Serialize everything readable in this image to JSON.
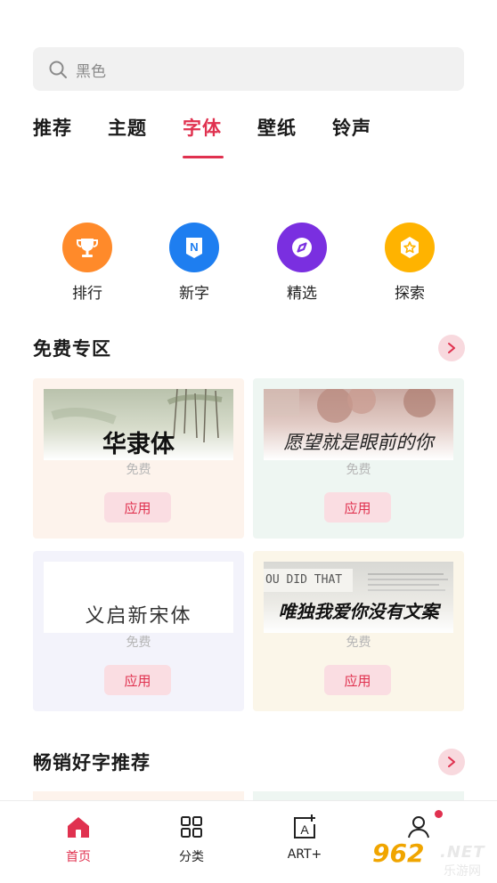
{
  "search": {
    "placeholder": "黑色"
  },
  "tabs": [
    {
      "label": "推荐"
    },
    {
      "label": "主题"
    },
    {
      "label": "字体"
    },
    {
      "label": "壁纸"
    },
    {
      "label": "铃声"
    }
  ],
  "active_tab": "字体",
  "quick_links": [
    {
      "label": "排行",
      "icon": "trophy-icon",
      "color": "#ff8a2a"
    },
    {
      "label": "新字",
      "icon": "new-n-icon",
      "color": "#1e7ef0"
    },
    {
      "label": "精选",
      "icon": "compass-icon",
      "color": "#7a2fe0"
    },
    {
      "label": "探索",
      "icon": "star-badge-icon",
      "color": "#ffb300"
    }
  ],
  "free_section": {
    "title": "免费专区",
    "fonts": [
      {
        "name": "华隶体",
        "price": "免费",
        "apply": "应用"
      },
      {
        "name": "愿望就是眼前的你",
        "price": "免费",
        "apply": "应用"
      },
      {
        "name": "义启新宋体",
        "price": "免费",
        "apply": "应用"
      },
      {
        "name": "唯独我爱你没有文案",
        "price": "免费",
        "apply": "应用",
        "preview_text": "OU DID THAT"
      }
    ]
  },
  "bestseller_section": {
    "title": "畅销好字推荐"
  },
  "bottom_nav": [
    {
      "label": "首页",
      "icon": "home-icon"
    },
    {
      "label": "分类",
      "icon": "grid-icon"
    },
    {
      "label": "ART+",
      "icon": "art-plus-icon"
    },
    {
      "label": "",
      "icon": "profile-icon"
    }
  ],
  "watermark": {
    "number": "962",
    "domain": ".NET",
    "site": "乐游网"
  },
  "colors": {
    "accent": "#e0314f",
    "apply_bg": "#fadde2",
    "search_bg": "#f1f1f1"
  }
}
